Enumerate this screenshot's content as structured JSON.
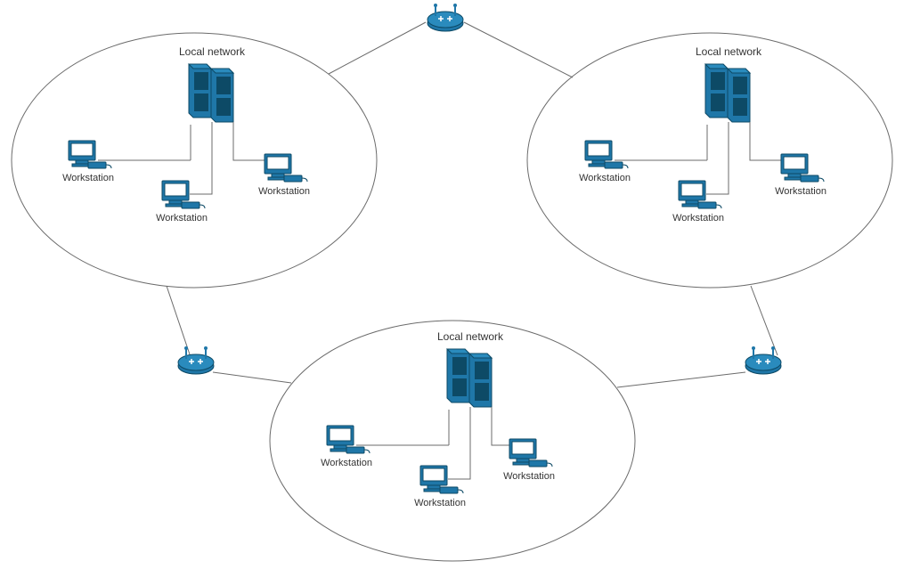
{
  "diagram": {
    "colors": {
      "device_fill": "#1f77a8",
      "device_stroke": "#0d4a66",
      "outline": "#6b6b6b",
      "label": "#333333"
    },
    "networks": [
      {
        "id": "net-top-left",
        "title": "Local network",
        "workstations": [
          {
            "id": "ws-tl-1",
            "label": "Workstation"
          },
          {
            "id": "ws-tl-2",
            "label": "Workstation"
          },
          {
            "id": "ws-tl-3",
            "label": "Workstation"
          }
        ]
      },
      {
        "id": "net-top-right",
        "title": "Local network",
        "workstations": [
          {
            "id": "ws-tr-1",
            "label": "Workstation"
          },
          {
            "id": "ws-tr-2",
            "label": "Workstation"
          },
          {
            "id": "ws-tr-3",
            "label": "Workstation"
          }
        ]
      },
      {
        "id": "net-bottom",
        "title": "Local network",
        "workstations": [
          {
            "id": "ws-b-1",
            "label": "Workstation"
          },
          {
            "id": "ws-b-2",
            "label": "Workstation"
          },
          {
            "id": "ws-b-3",
            "label": "Workstation"
          }
        ]
      }
    ],
    "routers": [
      {
        "id": "router-top"
      },
      {
        "id": "router-left"
      },
      {
        "id": "router-right"
      }
    ]
  }
}
